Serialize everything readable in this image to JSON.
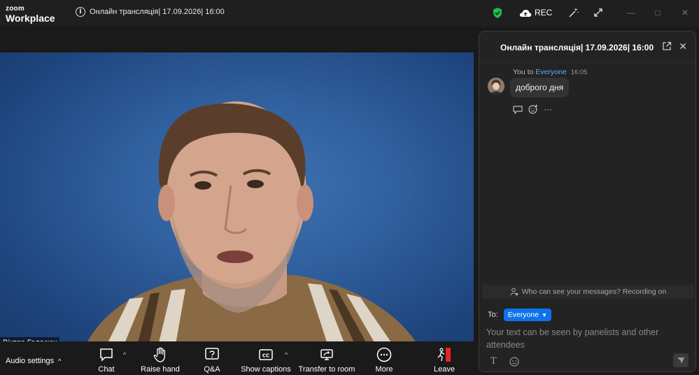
{
  "app": {
    "logo_line1": "zoom",
    "logo_line2": "Workplace"
  },
  "titlebar": {
    "meeting_title": "Онлайн трансляція| 17.09.2026| 16:00",
    "rec_label": "REC"
  },
  "video": {
    "participant_name": "Віктор Галасюк"
  },
  "toolbar": {
    "audio_settings": "Audio settings",
    "chat": "Chat",
    "raise_hand": "Raise hand",
    "qa": "Q&A",
    "captions": "Show captions",
    "transfer": "Transfer to room",
    "more": "More",
    "leave": "Leave"
  },
  "chat_panel": {
    "title": "Онлайн трансляція| 17.09.2026| 16:00",
    "message": {
      "sender": "You",
      "to_word": "to",
      "recipient": "Everyone",
      "time": "16:05",
      "text": "доброго дня"
    },
    "notice": "Who can see your messages? Recording on",
    "to_label": "To:",
    "to_value": "Everyone",
    "placeholder": "Your text can be seen by panelists and other attendees"
  },
  "colors": {
    "accent": "#0e72ed",
    "leave": "#e02828",
    "shield": "#1fbf4f",
    "mention": "#6aa9ff"
  }
}
